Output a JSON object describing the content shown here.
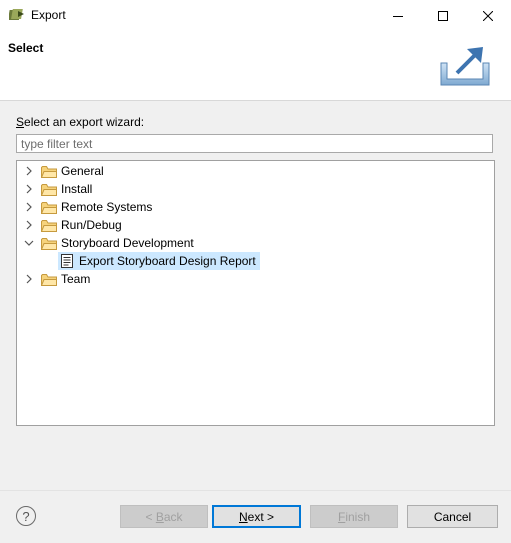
{
  "window": {
    "title": "Export",
    "icons": {
      "app": "export-wizard-icon",
      "minimize": "minimize-icon",
      "maximize": "maximize-icon",
      "close": "close-icon"
    }
  },
  "header": {
    "title": "Select",
    "graphic": "export-banner-icon"
  },
  "prompt": {
    "mnemonic": "S",
    "rest": "elect an export wizard:"
  },
  "filter": {
    "placeholder": "type filter text",
    "value": ""
  },
  "tree": {
    "nodes": [
      {
        "label": "General",
        "expanded": false
      },
      {
        "label": "Install",
        "expanded": false
      },
      {
        "label": "Remote Systems",
        "expanded": false
      },
      {
        "label": "Run/Debug",
        "expanded": false
      },
      {
        "label": "Storyboard Development",
        "expanded": true
      },
      {
        "label": "Export Storyboard Design Report",
        "child": true,
        "selected": true,
        "icon": "report-icon"
      },
      {
        "label": "Team",
        "expanded": false
      }
    ]
  },
  "buttons": {
    "help": "?",
    "back_pre": "< ",
    "back_mn": "B",
    "back_post": "ack",
    "next_mn": "N",
    "next_post": "ext >",
    "finish_mn": "F",
    "finish_post": "inish",
    "cancel": "Cancel"
  },
  "colors": {
    "selection": "#cce8ff",
    "folder": "#e8c06a",
    "default_button_border": "#0078d7"
  }
}
